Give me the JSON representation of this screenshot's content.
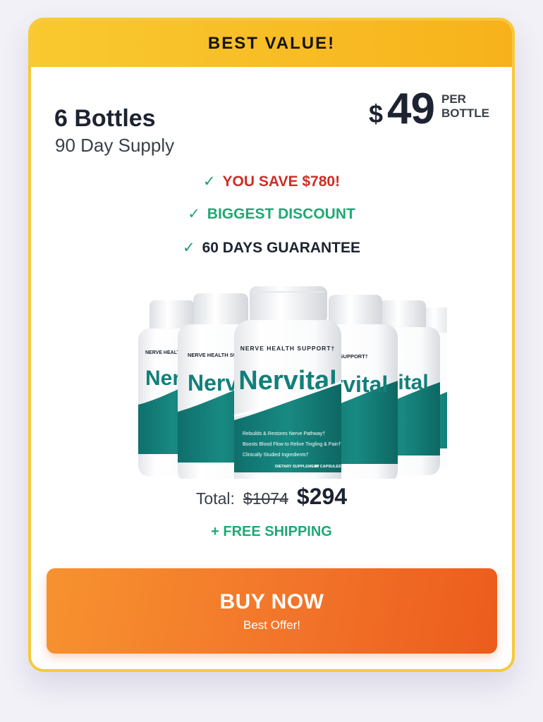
{
  "banner": {
    "label": "BEST VALUE!"
  },
  "package": {
    "title": "6 Bottles",
    "supply": "90 Day Supply"
  },
  "price": {
    "currency": "$",
    "amount": "49",
    "per_line1": "PER",
    "per_line2": "BOTTLE"
  },
  "benefits": [
    {
      "icon": "check-icon",
      "glyph": "✓",
      "text": "YOU SAVE $780!"
    },
    {
      "icon": "check-icon",
      "glyph": "✓",
      "text": "BIGGEST DISCOUNT"
    },
    {
      "icon": "check-icon",
      "glyph": "✓",
      "text": "60 DAYS GUARANTEE"
    }
  ],
  "product": {
    "brand": "Nervital",
    "tagline": "NERVE HEALTH SUPPORT†",
    "features": [
      "Rebuilds & Restores Nerve Pathway†",
      "Boosts Blood Flow to Relive Tingling & Pain†",
      "Clinically Studied Ingredients†"
    ],
    "footer_left": "DIETARY SUPPLEMENT",
    "footer_right": "60 CAPSULES"
  },
  "total": {
    "label": "Total:",
    "old_price": "$1074",
    "new_price": "$294"
  },
  "shipping": "+ FREE SHIPPING",
  "buy_button": {
    "label": "BUY NOW",
    "sublabel": "Best Offer!"
  },
  "colors": {
    "banner": "#f9c930",
    "card_border": "#f7c93a",
    "save_red": "#cf2d27",
    "green": "#1fa874",
    "teal": "#127f7a",
    "button_orange": "#f2742a"
  }
}
